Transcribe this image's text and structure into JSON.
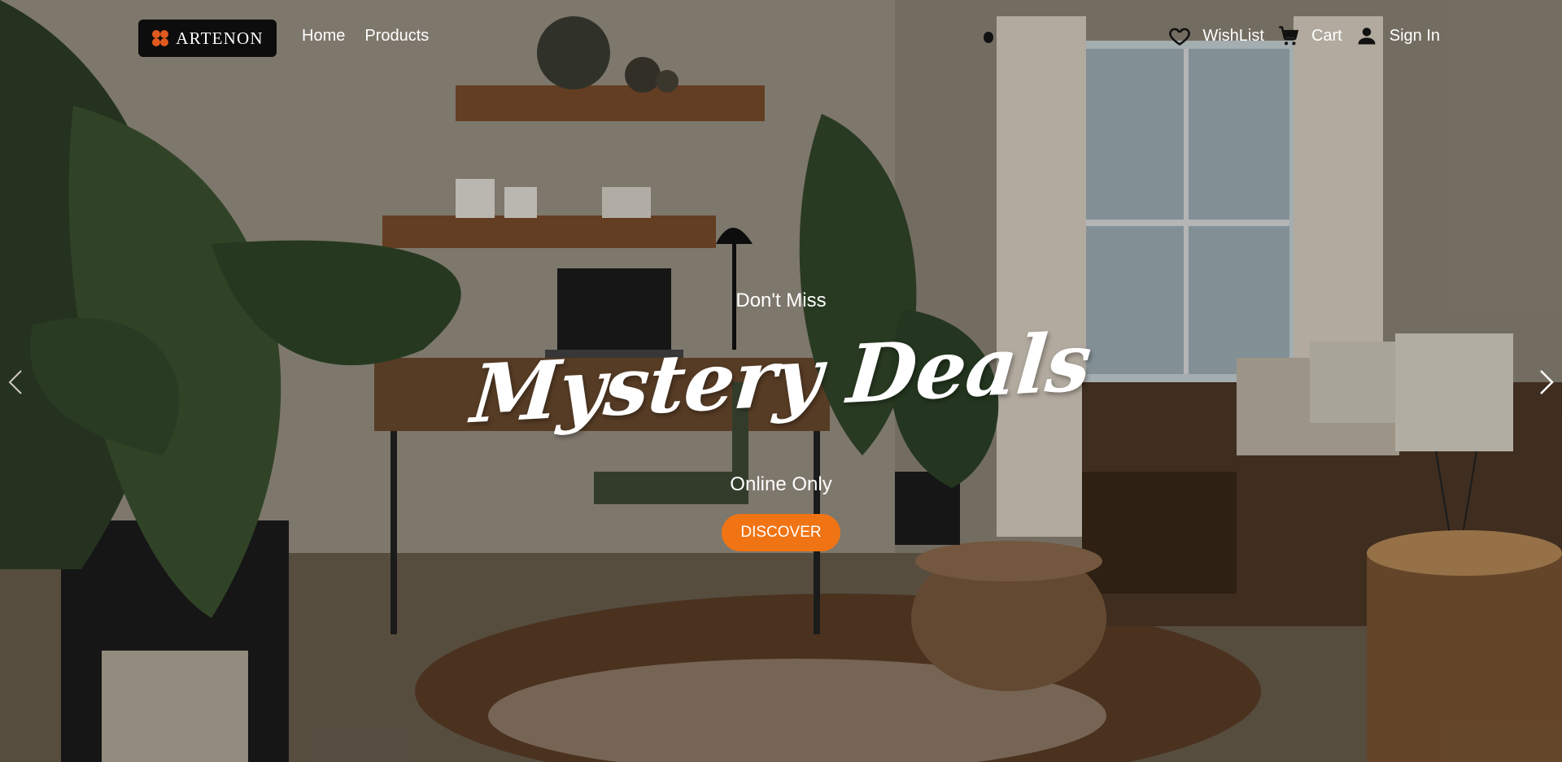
{
  "brand": {
    "name": "ARTENON",
    "logo_color": "#e05a1e"
  },
  "nav": [
    {
      "label": "Home"
    },
    {
      "label": "Products"
    }
  ],
  "actions": {
    "wishlist": {
      "label": "WishList",
      "icon": "heart-icon"
    },
    "cart": {
      "label": "Cart",
      "icon": "cart-icon"
    },
    "signin": {
      "label": "Sign In",
      "icon": "user-icon"
    }
  },
  "hero": {
    "pre_title": "Don't Miss",
    "title": "Mystery Deals",
    "subtitle": "Online Only",
    "cta_label": "DISCOVER",
    "cta_color": "#f07414",
    "prev_icon": "chevron-left-icon",
    "next_icon": "chevron-right-icon"
  }
}
